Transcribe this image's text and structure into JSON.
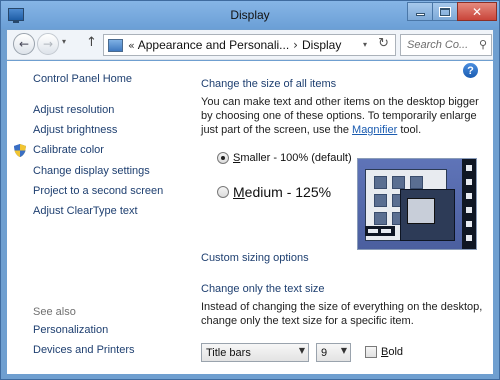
{
  "window": {
    "title": "Display",
    "close_glyph": "✕"
  },
  "nav": {
    "back_glyph": "←",
    "forward_glyph": "→",
    "dropdown_glyph": "▾",
    "up_glyph": "↑",
    "refresh_glyph": "↻"
  },
  "address": {
    "prefix": "«",
    "crumbs": [
      "Appearance and Personali...",
      "Display"
    ],
    "separator": "›"
  },
  "search": {
    "placeholder": "Search Co...",
    "icon_glyph": "⚲"
  },
  "help_glyph": "?",
  "sidebar": {
    "home": "Control Panel Home",
    "items": [
      "Adjust resolution",
      "Adjust brightness",
      "Calibrate color",
      "Change display settings",
      "Project to a second screen",
      "Adjust ClearType text"
    ],
    "see_also_label": "See also",
    "see_also_items": [
      "Personalization",
      "Devices and Printers"
    ]
  },
  "main": {
    "size_heading": "Change the size of all items",
    "size_paragraph_before": "You can make text and other items on the desktop bigger by choosing one of these options. To temporarily enlarge just part of the screen, use the ",
    "size_paragraph_link": "Magnifier",
    "size_paragraph_after": " tool.",
    "option_small_key": "S",
    "option_small_rest": "maller - 100% (default)",
    "option_medium_key": "M",
    "option_medium_rest": "edium - 125%",
    "selected_option": "small",
    "custom_sizing_link": "Custom sizing options",
    "text_heading": "Change only the text size",
    "text_paragraph": "Instead of changing the size of everything on the desktop, change only the text size for a specific item.",
    "item_select_value": "Title bars",
    "size_select_value": "9",
    "bold_key": "B",
    "bold_rest": "old",
    "bold_checked": false
  },
  "colors": {
    "link": "#1e3f70",
    "accent": "#1a5bb0",
    "titlebar": "#6b9fd6",
    "close": "#c9453a"
  }
}
